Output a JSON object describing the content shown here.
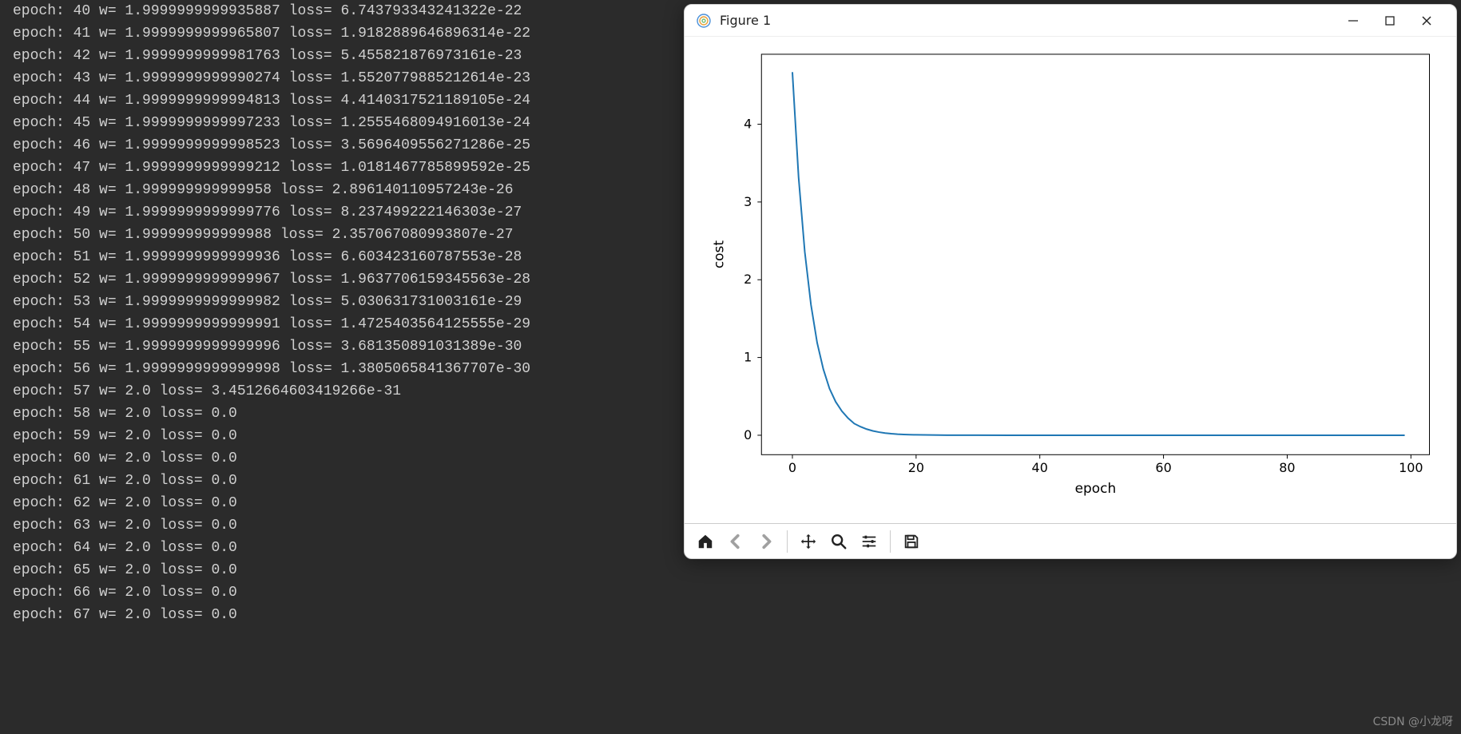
{
  "console_lines": [
    "epoch: 40 w= 1.9999999999935887 loss= 6.743793343241322e-22",
    "epoch: 41 w= 1.9999999999965807 loss= 1.9182889646896314e-22",
    "epoch: 42 w= 1.9999999999981763 loss= 5.455821876973161e-23",
    "epoch: 43 w= 1.9999999999990274 loss= 1.5520779885212614e-23",
    "epoch: 44 w= 1.9999999999994813 loss= 4.4140317521189105e-24",
    "epoch: 45 w= 1.9999999999997233 loss= 1.2555468094916013e-24",
    "epoch: 46 w= 1.9999999999998523 loss= 3.5696409556271286e-25",
    "epoch: 47 w= 1.9999999999999212 loss= 1.0181467785899592e-25",
    "epoch: 48 w= 1.999999999999958 loss= 2.896140110957243e-26",
    "epoch: 49 w= 1.9999999999999776 loss= 8.237499222146303e-27",
    "epoch: 50 w= 1.999999999999988 loss= 2.357067080993807e-27",
    "epoch: 51 w= 1.9999999999999936 loss= 6.603423160787553e-28",
    "epoch: 52 w= 1.9999999999999967 loss= 1.9637706159345563e-28",
    "epoch: 53 w= 1.9999999999999982 loss= 5.030631731003161e-29",
    "epoch: 54 w= 1.9999999999999991 loss= 1.4725403564125555e-29",
    "epoch: 55 w= 1.9999999999999996 loss= 3.681350891031389e-30",
    "epoch: 56 w= 1.9999999999999998 loss= 1.3805065841367707e-30",
    "epoch: 57 w= 2.0 loss= 3.4512664603419266e-31",
    "epoch: 58 w= 2.0 loss= 0.0",
    "epoch: 59 w= 2.0 loss= 0.0",
    "epoch: 60 w= 2.0 loss= 0.0",
    "epoch: 61 w= 2.0 loss= 0.0",
    "epoch: 62 w= 2.0 loss= 0.0",
    "epoch: 63 w= 2.0 loss= 0.0",
    "epoch: 64 w= 2.0 loss= 0.0",
    "epoch: 65 w= 2.0 loss= 0.0",
    "epoch: 66 w= 2.0 loss= 0.0",
    "epoch: 67 w= 2.0 loss= 0.0"
  ],
  "figure": {
    "title": "Figure 1",
    "xlabel": "epoch",
    "ylabel": "cost",
    "xticks": [
      "0",
      "20",
      "40",
      "60",
      "80",
      "100"
    ],
    "yticks": [
      "0",
      "1",
      "2",
      "3",
      "4"
    ],
    "xlim": [
      -5,
      103
    ],
    "ylim": [
      -0.25,
      4.9
    ],
    "line_color": "#1f77b4"
  },
  "chart_data": {
    "type": "line",
    "title": "",
    "xlabel": "epoch",
    "ylabel": "cost",
    "xlim": [
      -5,
      103
    ],
    "ylim": [
      -0.25,
      4.9
    ],
    "x": [
      0,
      1,
      2,
      3,
      4,
      5,
      6,
      7,
      8,
      9,
      10,
      11,
      12,
      13,
      14,
      15,
      16,
      17,
      18,
      19,
      20,
      25,
      30,
      35,
      40,
      45,
      50,
      55,
      60,
      65,
      70,
      75,
      80,
      85,
      90,
      95,
      99
    ],
    "values": [
      4.67,
      3.32,
      2.36,
      1.68,
      1.19,
      0.85,
      0.6,
      0.43,
      0.31,
      0.22,
      0.15,
      0.11,
      0.079,
      0.056,
      0.04,
      0.028,
      0.02,
      0.014,
      0.01,
      0.0073,
      0.0052,
      0.00094,
      0.00017,
      0,
      0,
      0,
      0,
      0,
      0,
      0,
      0,
      0,
      0,
      0,
      0,
      0,
      0
    ]
  },
  "toolbar": {
    "home": "Home",
    "back": "Back",
    "forward": "Forward",
    "pan": "Pan",
    "zoom": "Zoom",
    "configure": "Configure subplots",
    "save": "Save"
  },
  "watermark": "CSDN @小龙呀"
}
